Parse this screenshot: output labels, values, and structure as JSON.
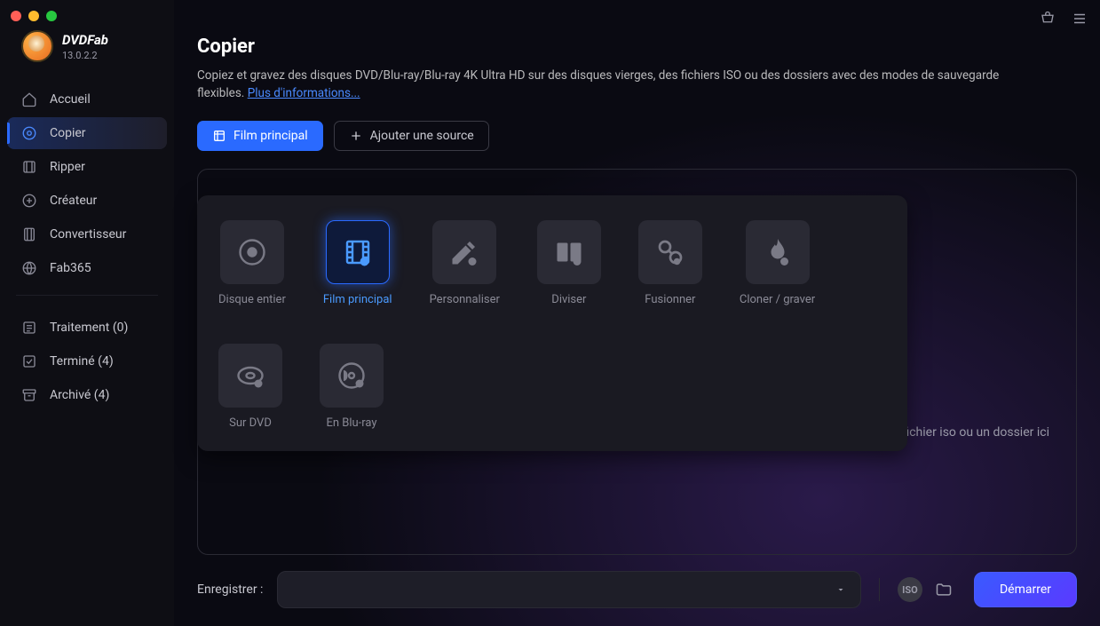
{
  "brand": {
    "name": "DVDFab",
    "version": "13.0.2.2"
  },
  "sidebar": {
    "items": [
      {
        "label": "Accueil",
        "icon": "home"
      },
      {
        "label": "Copier",
        "icon": "disc"
      },
      {
        "label": "Ripper",
        "icon": "rip"
      },
      {
        "label": "Créateur",
        "icon": "create"
      },
      {
        "label": "Convertisseur",
        "icon": "convert"
      },
      {
        "label": "Fab365",
        "icon": "globe"
      }
    ],
    "tasks": [
      {
        "label": "Traitement (0)",
        "icon": "list"
      },
      {
        "label": "Terminé (4)",
        "icon": "check"
      },
      {
        "label": "Archivé (4)",
        "icon": "archive"
      }
    ]
  },
  "page": {
    "title": "Copier",
    "desc_pre": "Copiez et gravez des disques DVD/Blu-ray/Blu-ray 4K Ultra HD sur des disques vierges, des fichiers ISO ou des dossiers avec des modes de sauvegarde flexibles. ",
    "more_label": "Plus d'informations..."
  },
  "buttons": {
    "mode": "Film principal",
    "add_source": "Ajouter une source"
  },
  "modes": [
    {
      "label": "Disque entier",
      "icon": "disc"
    },
    {
      "label": "Film principal",
      "icon": "film"
    },
    {
      "label": "Personnaliser",
      "icon": "edit"
    },
    {
      "label": "Diviser",
      "icon": "split"
    },
    {
      "label": "Fusionner",
      "icon": "merge"
    },
    {
      "label": "Cloner / graver",
      "icon": "burn"
    },
    {
      "label": "Sur DVD",
      "icon": "dvd"
    },
    {
      "label": "En Blu-ray",
      "icon": "bluray"
    }
  ],
  "modes_active_index": 1,
  "dropzone": {
    "hint": "aites glisser un fichier iso ou un dossier ici"
  },
  "bottom": {
    "save_label": "Enregistrer :",
    "iso_label": "ISO",
    "start_label": "Démarrer"
  }
}
